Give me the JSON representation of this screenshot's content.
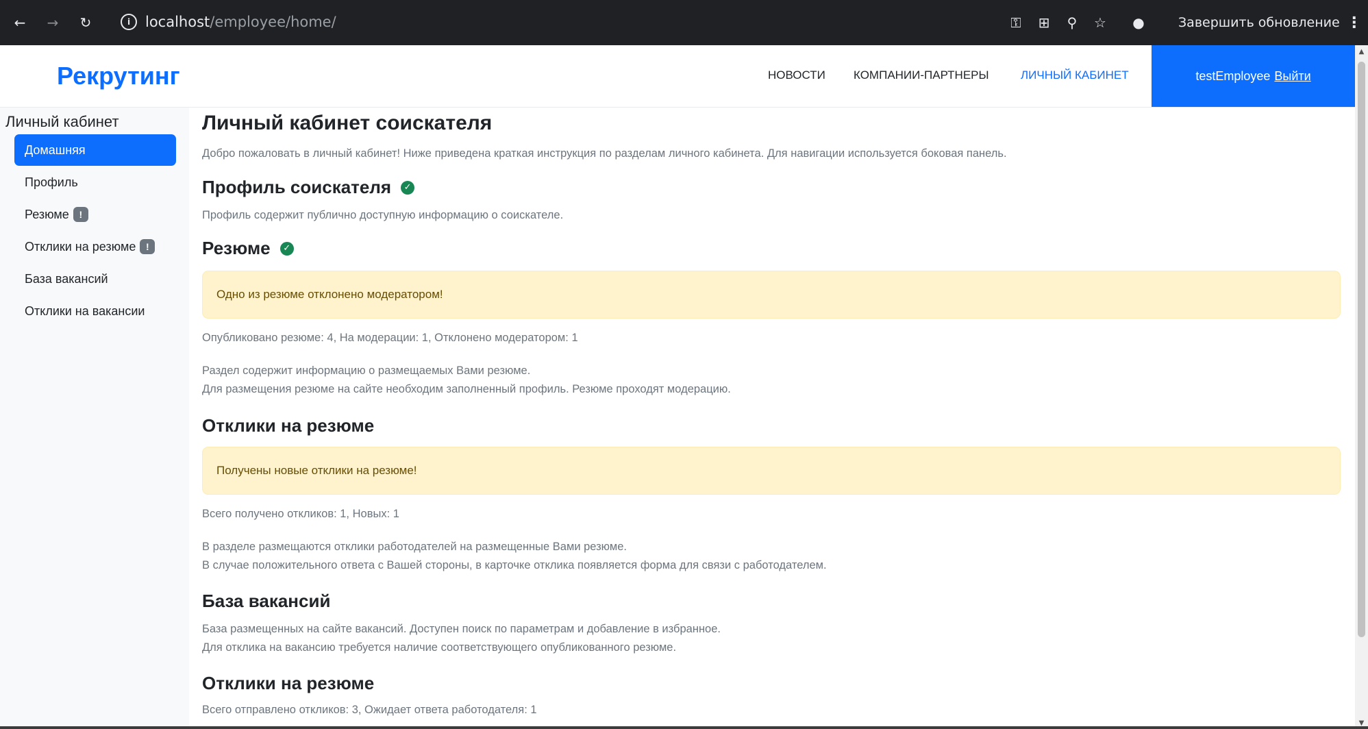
{
  "browser": {
    "url_host": "localhost",
    "url_path": "/employee/home/",
    "update_label": "Завершить обновление"
  },
  "header": {
    "brand": "Рекрутинг",
    "nav": [
      {
        "label": "НОВОСТИ",
        "active": false
      },
      {
        "label": "КОМПАНИИ-ПАРТНЕРЫ",
        "active": false
      },
      {
        "label": "ЛИЧНЫЙ КАБИНЕТ",
        "active": true
      }
    ],
    "username": "testEmployee",
    "logout_label": "Выйти",
    "accent_color": "#0d6efd"
  },
  "sidebar": {
    "title": "Личный кабинет",
    "items": [
      {
        "label": "Домашняя",
        "active": true,
        "badge": null
      },
      {
        "label": "Профиль",
        "active": false,
        "badge": null
      },
      {
        "label": "Резюме",
        "active": false,
        "badge": "!"
      },
      {
        "label": "Отклики на резюме",
        "active": false,
        "badge": "!"
      },
      {
        "label": "База вакансий",
        "active": false,
        "badge": null
      },
      {
        "label": "Отклики на вакансии",
        "active": false,
        "badge": null
      }
    ]
  },
  "main": {
    "title": "Личный кабинет соискателя",
    "intro": "Добро пожаловать в личный кабинет! Ниже приведена краткая инструкция по разделам личного кабинета. Для навигации используется боковая панель.",
    "profile": {
      "heading": "Профиль соискателя",
      "status_icon": "check-circle-icon",
      "text": "Профиль содержит публично доступную информацию о соискателе."
    },
    "resume": {
      "heading": "Резюме",
      "status_icon": "check-circle-icon",
      "alert": "Одно из резюме отклонено модератором!",
      "stats": "Опубликовано резюме: 4, На модерации: 1, Отклонено модератором: 1",
      "text_line1": "Раздел содержит информацию о размещаемых Вами резюме.",
      "text_line2": "Для размещения резюме на сайте необходим заполненный профиль. Резюме проходят модерацию."
    },
    "resume_responses": {
      "heading": "Отклики на резюме",
      "alert": "Получены новые отклики на резюме!",
      "stats": "Всего получено откликов: 1, Новых: 1",
      "text_line1": "В разделе размещаются отклики работодателей на размещенные Вами резюме.",
      "text_line2": "В случае положительного ответа с Вашей стороны, в карточке отклика появляется форма для связи с работодателем."
    },
    "vacancies": {
      "heading": "База вакансий",
      "text_line1": "База размещенных на сайте вакансий. Доступен поиск по параметрам и добавление в избранное.",
      "text_line2": "Для отклика на вакансию требуется наличие соответствующего опубликованного резюме."
    },
    "vacancy_responses": {
      "heading": "Отклики на резюме",
      "stats": "Всего отправлено откликов: 3, Ожидает ответа работодателя: 1"
    }
  }
}
